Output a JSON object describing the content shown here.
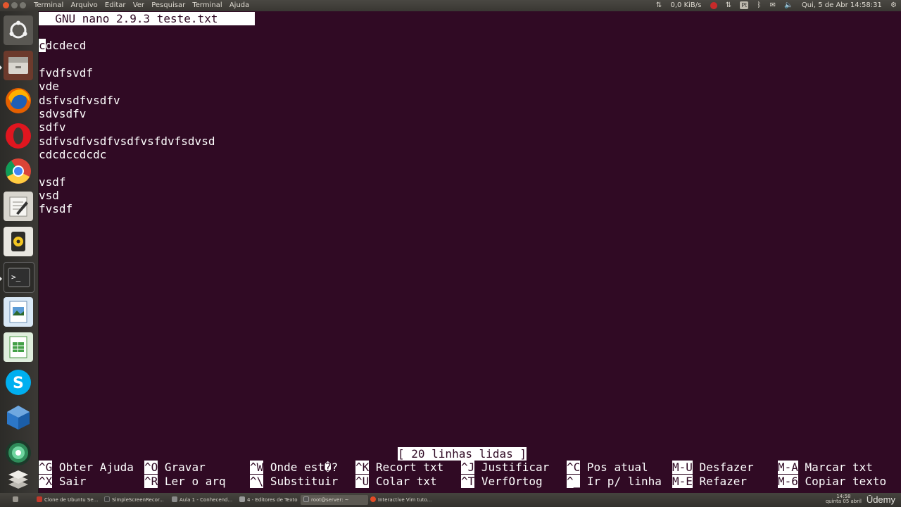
{
  "topbar": {
    "menus": [
      "Terminal",
      "Arquivo",
      "Editar",
      "Ver",
      "Pesquisar",
      "Terminal",
      "Ajuda"
    ],
    "network_speed": "0,0 KiB/s",
    "keyboard_layout": "Pt",
    "datetime": "Qui, 5 de Abr 14:58:31"
  },
  "launcher": {
    "apps": [
      "ubuntu-dash",
      "files",
      "firefox",
      "opera",
      "chrome",
      "text-editor",
      "rhythmbox",
      "terminal",
      "image-viewer",
      "spreadsheet",
      "skype",
      "virtualbox",
      "browser-globe",
      "workspaces"
    ]
  },
  "nano": {
    "title": "  GNU nano 2.9.3 teste.txt",
    "cursor_char": "c",
    "first_line_rest": "dcdecd",
    "lines": [
      "",
      "fvdfsvdf",
      "vde",
      "dsfvsdfvsdfv",
      "sdvsdfv",
      "sdfv",
      "sdfvsdfvsdfvsdfvsfdvfsdvsd",
      "cdcdccdcdc",
      "",
      "vsdf",
      "vsd",
      "fvsdf"
    ],
    "status": "[ 20 linhas lidas ]",
    "shortcuts_row1": [
      {
        "key": "^G",
        "label": "Obter Ajuda"
      },
      {
        "key": "^O",
        "label": "Gravar"
      },
      {
        "key": "^W",
        "label": "Onde est�?"
      },
      {
        "key": "^K",
        "label": "Recort txt"
      },
      {
        "key": "^J",
        "label": "Justificar"
      },
      {
        "key": "^C",
        "label": "Pos atual"
      },
      {
        "key": "M-U",
        "label": "Desfazer"
      },
      {
        "key": "M-A",
        "label": "Marcar txt"
      }
    ],
    "shortcuts_row2": [
      {
        "key": "^X",
        "label": "Sair"
      },
      {
        "key": "^R",
        "label": "Ler o arq"
      },
      {
        "key": "^\\",
        "label": "Substituir"
      },
      {
        "key": "^U",
        "label": "Colar txt"
      },
      {
        "key": "^T",
        "label": "VerfOrtog"
      },
      {
        "key": "^_",
        "label": "Ir p/ linha"
      },
      {
        "key": "M-E",
        "label": "Refazer"
      },
      {
        "key": "M-6",
        "label": "Copiar texto"
      }
    ]
  },
  "taskbar": {
    "windows": [
      {
        "label": "Clone de Ubuntu Se...",
        "color": "#c0392b"
      },
      {
        "label": "SimpleScreenRecor...",
        "color": "#3a3a3a"
      },
      {
        "label": "Aula 1 - Conhecend...",
        "color": "#8a8a8a"
      },
      {
        "label": "4 - Editores de Texto",
        "color": "#9a9a9a"
      },
      {
        "label": "root@server: ~",
        "color": "#555555"
      },
      {
        "label": "Interactive Vim tuto...",
        "color": "#e24b26"
      }
    ],
    "clock_time": "14:58",
    "clock_date": "quinta 05 abril",
    "brand": "Ūdemy"
  },
  "colors": {
    "terminal_bg": "#300a24",
    "terminal_fg": "#ffffff"
  }
}
